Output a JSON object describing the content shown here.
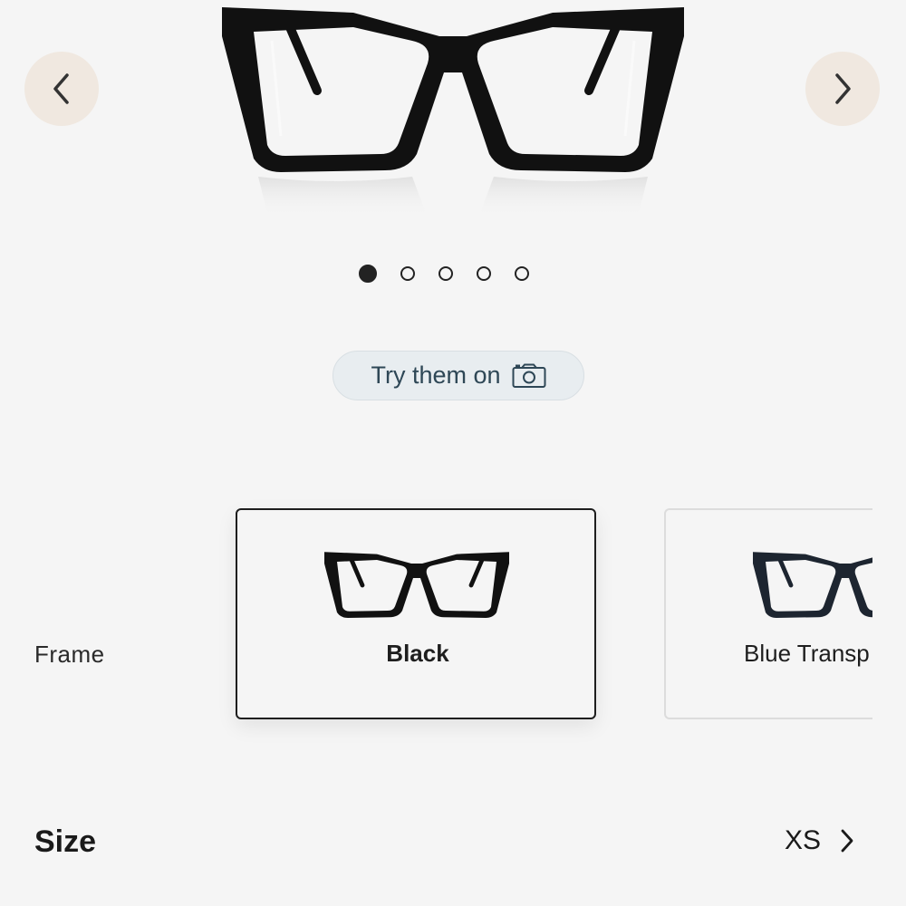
{
  "product": {
    "image_icon": "eyeglasses-black-image"
  },
  "carousel": {
    "prev_icon": "chevron-left-icon",
    "next_icon": "chevron-right-icon",
    "dots_total": 5,
    "active_index": 0
  },
  "try_on": {
    "label": "Try them on",
    "icon": "camera-icon"
  },
  "frame": {
    "label": "Frame",
    "options": [
      {
        "name": "Black",
        "selected": true
      },
      {
        "name": "Blue Transp",
        "selected": false
      }
    ]
  },
  "size": {
    "label": "Size",
    "value": "XS",
    "icon": "chevron-right-icon"
  },
  "colors": {
    "background": "#f5f5f5",
    "nav_button": "#f0e8e0",
    "tryon_bg": "#e8edf0",
    "tryon_text": "#2e4756"
  }
}
